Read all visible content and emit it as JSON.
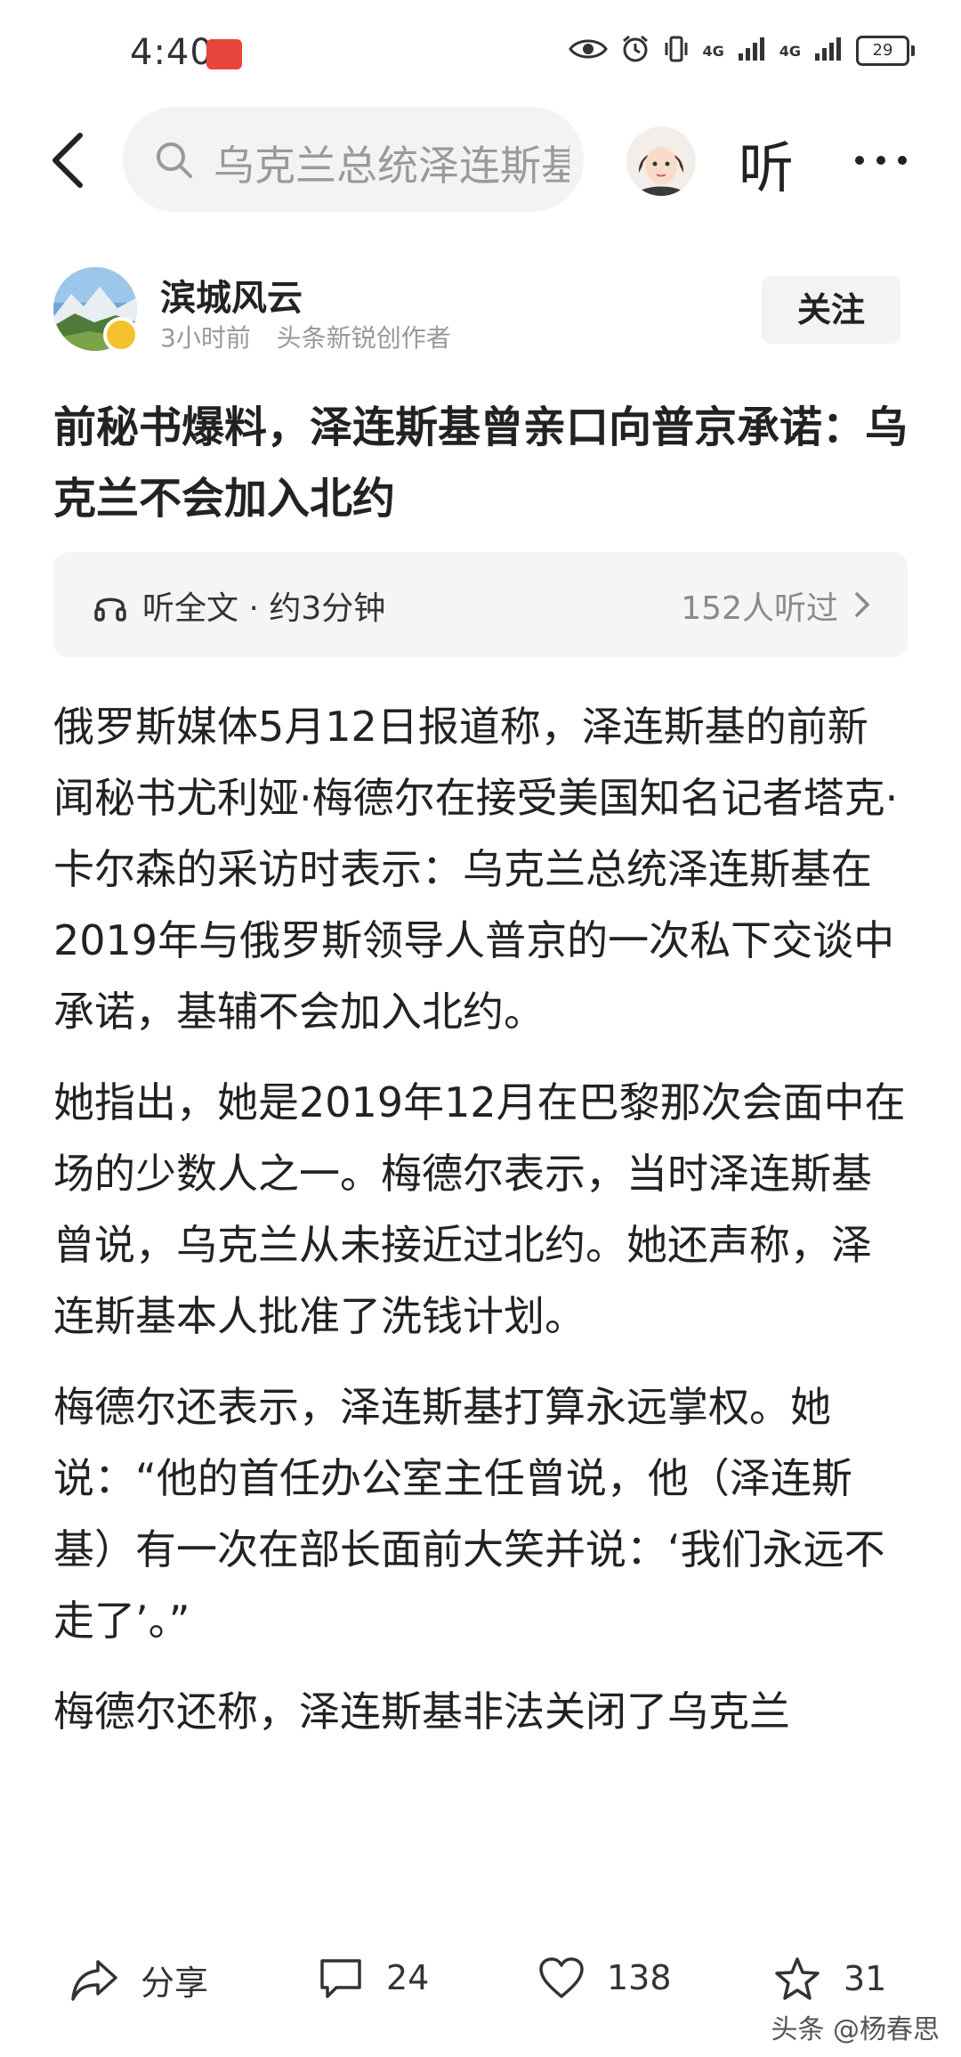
{
  "status_bar": {
    "time": "4:40",
    "network_1": "4G",
    "network_2": "4G",
    "battery": "29"
  },
  "search": {
    "text": "乌克兰总统泽连斯基"
  },
  "nav": {
    "listen_label": "听"
  },
  "author": {
    "name": "滨城风云",
    "time_ago": "3小时前",
    "role": "头条新锐创作者",
    "follow_label": "关注"
  },
  "article": {
    "title": "前秘书爆料，泽连斯基曾亲口向普京承诺：乌克兰不会加入北约",
    "audio": {
      "label": "听全文 · 约3分钟",
      "listeners": "152人听过"
    },
    "paragraphs": [
      "俄罗斯媒体5月12日报道称，泽连斯基的前新闻秘书尤利娅·梅德尔在接受美国知名记者塔克·卡尔森的采访时表示：乌克兰总统泽连斯基在2019年与俄罗斯领导人普京的一次私下交谈中承诺，基辅不会加入北约。",
      "她指出，她是2019年12月在巴黎那次会面中在场的少数人之一。梅德尔表示，当时泽连斯基曾说，乌克兰从未接近过北约。她还声称，泽连斯基本人批准了洗钱计划。",
      "梅德尔还表示，泽连斯基打算永远掌权。她说：“他的首任办公室主任曾说，他（泽连斯基）有一次在部长面前大笑并说：‘我们永远不走了’。”",
      "梅德尔还称，泽连斯基非法关闭了乌克兰"
    ]
  },
  "actions": {
    "share_label": "分享",
    "comments": "24",
    "likes": "138",
    "favorites": "31"
  },
  "watermark": "头条 @杨春思"
}
